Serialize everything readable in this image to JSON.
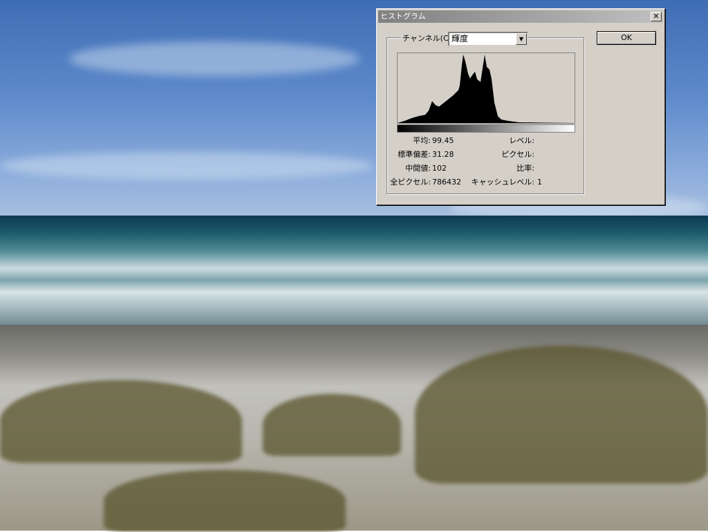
{
  "dialog": {
    "title": "ヒストグラム",
    "close_label": "✕",
    "channel_label": "チャンネル(C):",
    "channel_value": "輝度",
    "ok_label": "OK",
    "stats": {
      "mean_label": "平均:",
      "mean": "99.45",
      "stddev_label": "標準偏差:",
      "stddev": "31.28",
      "median_label": "中間値:",
      "median": "102",
      "pixels_label": "全ピクセル:",
      "pixels": "786432",
      "level_label": "レベル:",
      "count_label": "ピクセル:",
      "percentile_label": "比率:",
      "cache_label": "キャッシュレベル:",
      "cache": "1"
    }
  },
  "chart_data": {
    "type": "area",
    "title": "ヒストグラム",
    "xlabel": "輝度",
    "ylabel": "",
    "xlim": [
      0,
      255
    ],
    "ylim": [
      0,
      100
    ],
    "x": [
      0,
      10,
      20,
      30,
      40,
      45,
      50,
      55,
      60,
      70,
      80,
      85,
      88,
      90,
      93,
      95,
      98,
      102,
      105,
      108,
      112,
      115,
      120,
      123,
      126,
      129,
      133,
      136,
      140,
      145,
      150,
      160,
      175,
      210,
      255
    ],
    "values": [
      0,
      3,
      7,
      10,
      12,
      18,
      32,
      26,
      24,
      32,
      40,
      45,
      48,
      55,
      85,
      100,
      90,
      72,
      65,
      70,
      75,
      64,
      60,
      80,
      100,
      82,
      78,
      64,
      30,
      10,
      5,
      3,
      1,
      0.5,
      0
    ]
  }
}
